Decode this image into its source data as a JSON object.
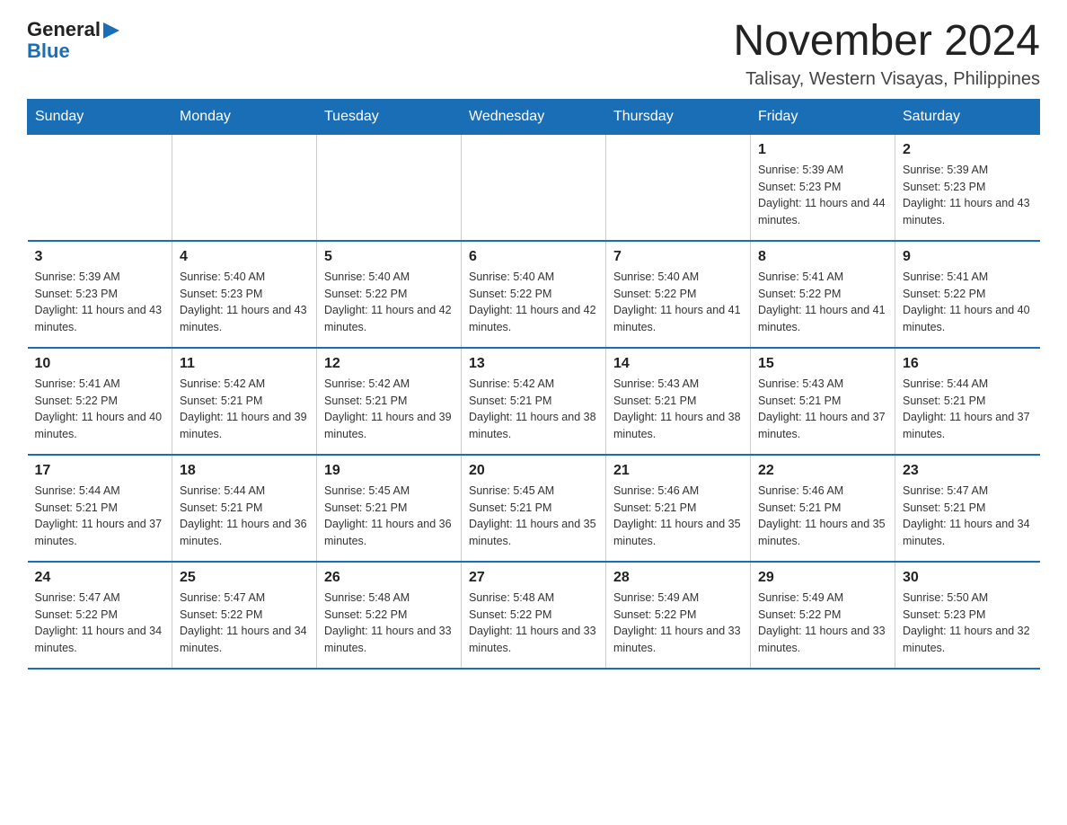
{
  "header": {
    "month_title": "November 2024",
    "location": "Talisay, Western Visayas, Philippines",
    "logo_general": "General",
    "logo_blue": "Blue"
  },
  "weekdays": [
    "Sunday",
    "Monday",
    "Tuesday",
    "Wednesday",
    "Thursday",
    "Friday",
    "Saturday"
  ],
  "weeks": [
    [
      {
        "day": "",
        "info": ""
      },
      {
        "day": "",
        "info": ""
      },
      {
        "day": "",
        "info": ""
      },
      {
        "day": "",
        "info": ""
      },
      {
        "day": "",
        "info": ""
      },
      {
        "day": "1",
        "info": "Sunrise: 5:39 AM\nSunset: 5:23 PM\nDaylight: 11 hours and 44 minutes."
      },
      {
        "day": "2",
        "info": "Sunrise: 5:39 AM\nSunset: 5:23 PM\nDaylight: 11 hours and 43 minutes."
      }
    ],
    [
      {
        "day": "3",
        "info": "Sunrise: 5:39 AM\nSunset: 5:23 PM\nDaylight: 11 hours and 43 minutes."
      },
      {
        "day": "4",
        "info": "Sunrise: 5:40 AM\nSunset: 5:23 PM\nDaylight: 11 hours and 43 minutes."
      },
      {
        "day": "5",
        "info": "Sunrise: 5:40 AM\nSunset: 5:22 PM\nDaylight: 11 hours and 42 minutes."
      },
      {
        "day": "6",
        "info": "Sunrise: 5:40 AM\nSunset: 5:22 PM\nDaylight: 11 hours and 42 minutes."
      },
      {
        "day": "7",
        "info": "Sunrise: 5:40 AM\nSunset: 5:22 PM\nDaylight: 11 hours and 41 minutes."
      },
      {
        "day": "8",
        "info": "Sunrise: 5:41 AM\nSunset: 5:22 PM\nDaylight: 11 hours and 41 minutes."
      },
      {
        "day": "9",
        "info": "Sunrise: 5:41 AM\nSunset: 5:22 PM\nDaylight: 11 hours and 40 minutes."
      }
    ],
    [
      {
        "day": "10",
        "info": "Sunrise: 5:41 AM\nSunset: 5:22 PM\nDaylight: 11 hours and 40 minutes."
      },
      {
        "day": "11",
        "info": "Sunrise: 5:42 AM\nSunset: 5:21 PM\nDaylight: 11 hours and 39 minutes."
      },
      {
        "day": "12",
        "info": "Sunrise: 5:42 AM\nSunset: 5:21 PM\nDaylight: 11 hours and 39 minutes."
      },
      {
        "day": "13",
        "info": "Sunrise: 5:42 AM\nSunset: 5:21 PM\nDaylight: 11 hours and 38 minutes."
      },
      {
        "day": "14",
        "info": "Sunrise: 5:43 AM\nSunset: 5:21 PM\nDaylight: 11 hours and 38 minutes."
      },
      {
        "day": "15",
        "info": "Sunrise: 5:43 AM\nSunset: 5:21 PM\nDaylight: 11 hours and 37 minutes."
      },
      {
        "day": "16",
        "info": "Sunrise: 5:44 AM\nSunset: 5:21 PM\nDaylight: 11 hours and 37 minutes."
      }
    ],
    [
      {
        "day": "17",
        "info": "Sunrise: 5:44 AM\nSunset: 5:21 PM\nDaylight: 11 hours and 37 minutes."
      },
      {
        "day": "18",
        "info": "Sunrise: 5:44 AM\nSunset: 5:21 PM\nDaylight: 11 hours and 36 minutes."
      },
      {
        "day": "19",
        "info": "Sunrise: 5:45 AM\nSunset: 5:21 PM\nDaylight: 11 hours and 36 minutes."
      },
      {
        "day": "20",
        "info": "Sunrise: 5:45 AM\nSunset: 5:21 PM\nDaylight: 11 hours and 35 minutes."
      },
      {
        "day": "21",
        "info": "Sunrise: 5:46 AM\nSunset: 5:21 PM\nDaylight: 11 hours and 35 minutes."
      },
      {
        "day": "22",
        "info": "Sunrise: 5:46 AM\nSunset: 5:21 PM\nDaylight: 11 hours and 35 minutes."
      },
      {
        "day": "23",
        "info": "Sunrise: 5:47 AM\nSunset: 5:21 PM\nDaylight: 11 hours and 34 minutes."
      }
    ],
    [
      {
        "day": "24",
        "info": "Sunrise: 5:47 AM\nSunset: 5:22 PM\nDaylight: 11 hours and 34 minutes."
      },
      {
        "day": "25",
        "info": "Sunrise: 5:47 AM\nSunset: 5:22 PM\nDaylight: 11 hours and 34 minutes."
      },
      {
        "day": "26",
        "info": "Sunrise: 5:48 AM\nSunset: 5:22 PM\nDaylight: 11 hours and 33 minutes."
      },
      {
        "day": "27",
        "info": "Sunrise: 5:48 AM\nSunset: 5:22 PM\nDaylight: 11 hours and 33 minutes."
      },
      {
        "day": "28",
        "info": "Sunrise: 5:49 AM\nSunset: 5:22 PM\nDaylight: 11 hours and 33 minutes."
      },
      {
        "day": "29",
        "info": "Sunrise: 5:49 AM\nSunset: 5:22 PM\nDaylight: 11 hours and 33 minutes."
      },
      {
        "day": "30",
        "info": "Sunrise: 5:50 AM\nSunset: 5:23 PM\nDaylight: 11 hours and 32 minutes."
      }
    ]
  ]
}
